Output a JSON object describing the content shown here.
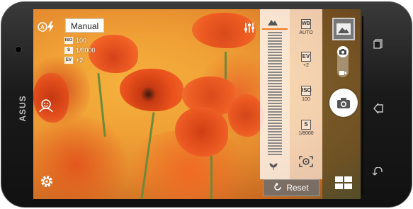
{
  "device": {
    "brand": "ASUS"
  },
  "camera": {
    "mode_label": "Manual",
    "params": [
      {
        "key": "ISO",
        "value": "100"
      },
      {
        "key": "S",
        "value": "1/8000"
      },
      {
        "key": "EV",
        "value": "+2"
      }
    ],
    "adjustments": [
      {
        "label": "WB",
        "value": "AUTO"
      },
      {
        "label": "EV",
        "value": "+2"
      },
      {
        "label": "ISO",
        "value": "100"
      },
      {
        "label": "S",
        "value": "1/8000"
      }
    ],
    "reset_label": "Reset"
  },
  "colors": {
    "accent": "#f07a1e",
    "panel": "#ffffff"
  }
}
